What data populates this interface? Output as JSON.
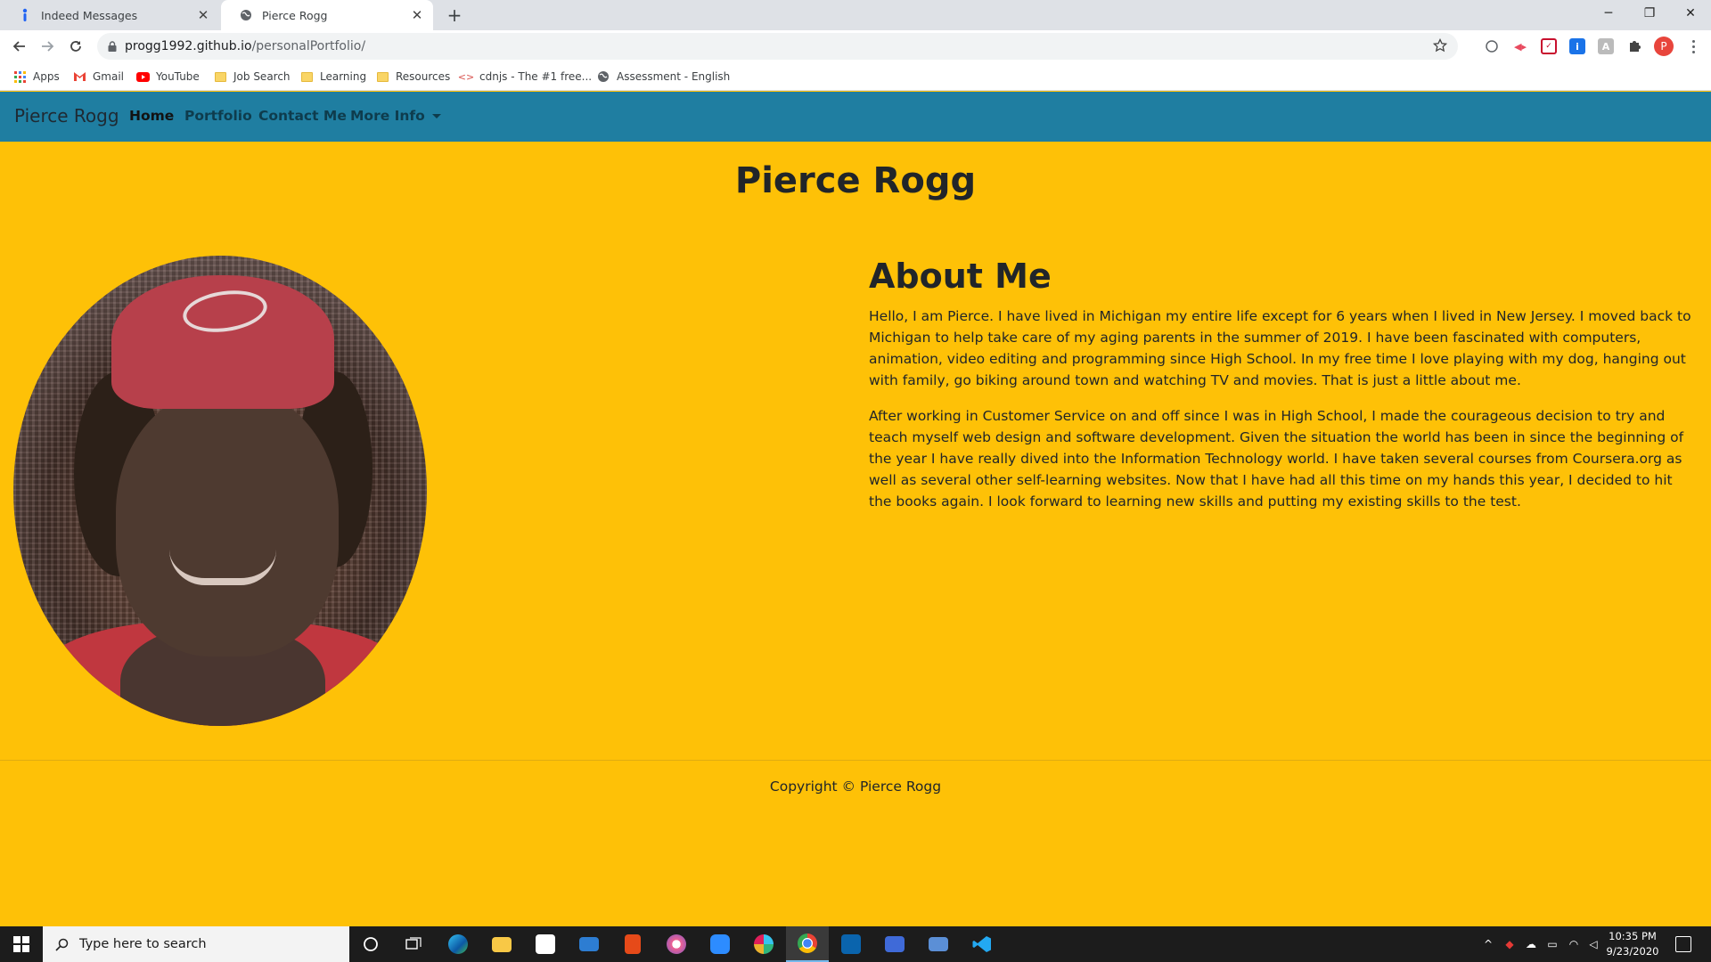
{
  "browser": {
    "tabs": [
      {
        "title": "Indeed Messages",
        "icon": "indeed-icon",
        "active": false
      },
      {
        "title": "Pierce Rogg",
        "icon": "globe-icon",
        "active": true
      }
    ],
    "url": {
      "host": "progg1992.github.io",
      "path": "/personalPortfolio/"
    },
    "profile_initial": "P",
    "bookmarks": [
      {
        "label": "Apps",
        "icon": "apps-grid-icon"
      },
      {
        "label": "Gmail",
        "icon": "gmail-icon"
      },
      {
        "label": "YouTube",
        "icon": "youtube-icon"
      },
      {
        "label": "Job Search",
        "icon": "folder-icon"
      },
      {
        "label": "Learning",
        "icon": "folder-icon"
      },
      {
        "label": "Resources",
        "icon": "folder-icon"
      },
      {
        "label": "cdnjs - The #1 free...",
        "icon": "code-icon"
      },
      {
        "label": "Assessment - English",
        "icon": "globe-icon"
      }
    ]
  },
  "site": {
    "brand": "Pierce Rogg",
    "nav": {
      "home": "Home",
      "portfolio": "Portfolio",
      "contact": "Contact Me",
      "more": "More Info"
    },
    "title": "Pierce Rogg",
    "about": {
      "heading": "About Me",
      "p1": "Hello, I am Pierce. I have lived in Michigan my entire life except for 6 years when I lived in New Jersey. I moved back to Michigan to help take care of my aging parents in the summer of 2019. I have been fascinated with computers, animation, video editing and programming since High School. In my free time I love playing with my dog, hanging out with family, go biking around town and watching TV and movies. That is just a little about me.",
      "p2": "After working in Customer Service on and off since I was in High School, I made the courageous decision to try and teach myself web design and software development. Given the situation the world has been in since the beginning of the year I have really dived into the Information Technology world. I have taken several courses from Coursera.org as well as several other self-learning websites. Now that I have had all this time on my hands this year, I decided to hit the books again. I look forward to learning new skills and putting my existing skills to the test."
    },
    "footer": "Copyright © Pierce Rogg",
    "colors": {
      "background": "#fec107",
      "navbar": "#1f7ea1"
    }
  },
  "taskbar": {
    "search_placeholder": "Type here to search",
    "time": "10:35 PM",
    "date": "9/23/2020"
  }
}
